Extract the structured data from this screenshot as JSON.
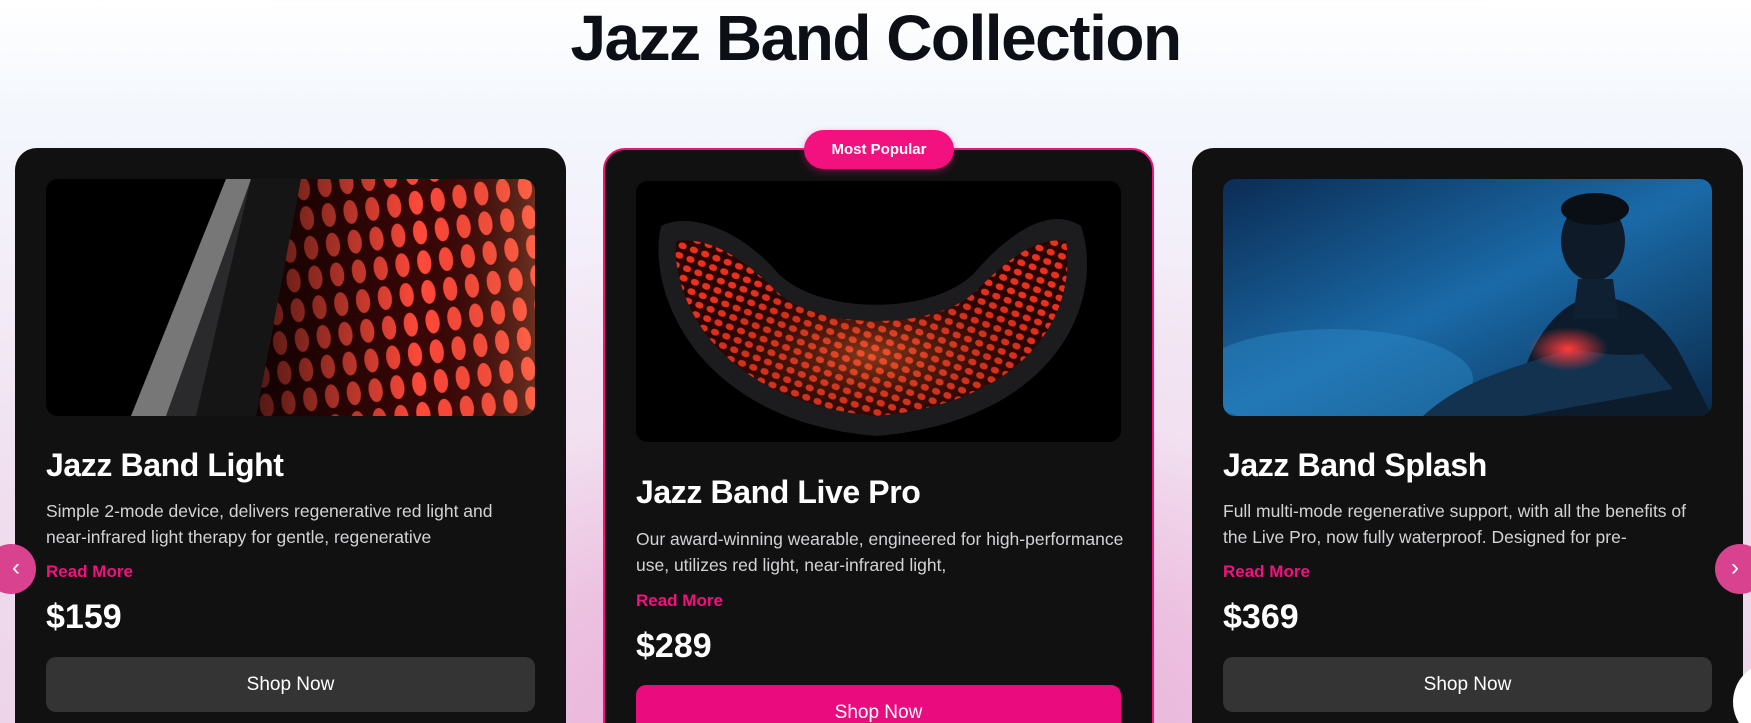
{
  "section": {
    "title": "Jazz Band Collection"
  },
  "badge": {
    "label": "Most Popular"
  },
  "nav": {
    "prev_label": "‹",
    "next_label": "›"
  },
  "colors": {
    "accent": "#f2117f",
    "card_bg": "#111112",
    "secondary_button": "#343435"
  },
  "products": [
    {
      "title": "Jazz Band Light",
      "description": "Simple 2-mode device, delivers regenerative red light and near-infrared light therapy for gentle, regenerative",
      "read_more": "Read More",
      "price": "$159",
      "button": "Shop Now",
      "image": "red-led-mesh-closeup"
    },
    {
      "title": "Jazz Band Live Pro",
      "description": "Our award-winning wearable, engineered for high-performance use, utilizes red light, near-infrared light,",
      "read_more": "Read More",
      "price": "$289",
      "button": "Shop Now",
      "image": "curved-red-led-band"
    },
    {
      "title": "Jazz Band Splash",
      "description": "Full multi-mode regenerative support, with all the benefits of the Live Pro, now fully waterproof. Designed for pre-",
      "read_more": "Read More",
      "price": "$369",
      "button": "Shop Now",
      "image": "man-wearing-band-in-water"
    }
  ]
}
